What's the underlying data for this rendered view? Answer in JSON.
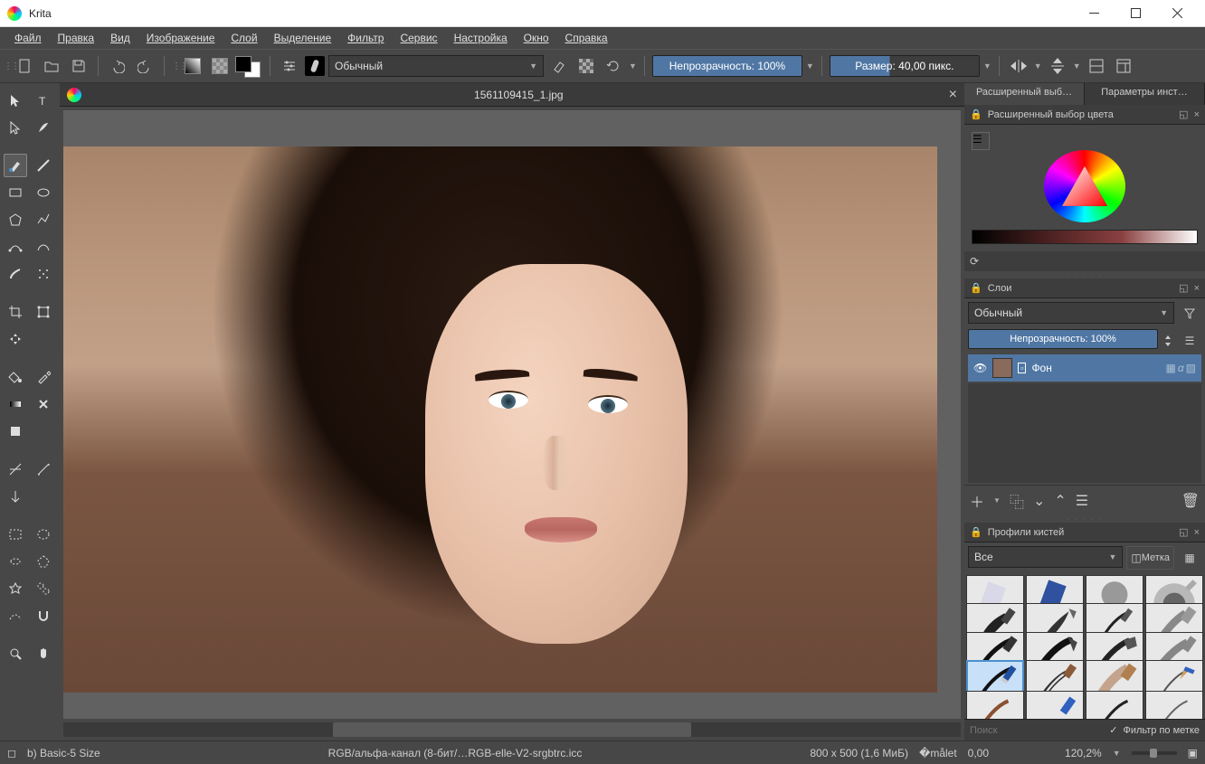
{
  "app": {
    "title": "Krita"
  },
  "menu": [
    "Файл",
    "Правка",
    "Вид",
    "Изображение",
    "Слой",
    "Выделение",
    "Фильтр",
    "Сервис",
    "Настройка",
    "Окно",
    "Справка"
  ],
  "toolbar": {
    "blend_mode": "Обычный",
    "opacity_label": "Непрозрачность: 100%",
    "size_label": "Размер: 40,00 пикс."
  },
  "document": {
    "filename": "1561109415_1.jpg"
  },
  "dock_tabs": {
    "left": "Расширенный выб…",
    "right": "Параметры инст…"
  },
  "color_picker": {
    "title": "Расширенный выбор цвета"
  },
  "layers": {
    "title": "Слои",
    "blend_mode": "Обычный",
    "opacity": "Непрозрачность:  100%",
    "items": [
      {
        "name": "Фон"
      }
    ]
  },
  "brushes": {
    "title": "Профили кистей",
    "filter": "Все",
    "tag_label": "Метка",
    "search_placeholder": "Поиск",
    "filter_by_tag": "Фильтр по метке"
  },
  "status": {
    "brush": "b) Basic-5 Size",
    "colorspace": "RGB/альфа-канал (8-бит/…RGB-elle-V2-srgbtrc.icc",
    "dimensions": "800 x 500 (1,6 МиБ)",
    "rotation": "0,00",
    "zoom": "120,2%"
  }
}
